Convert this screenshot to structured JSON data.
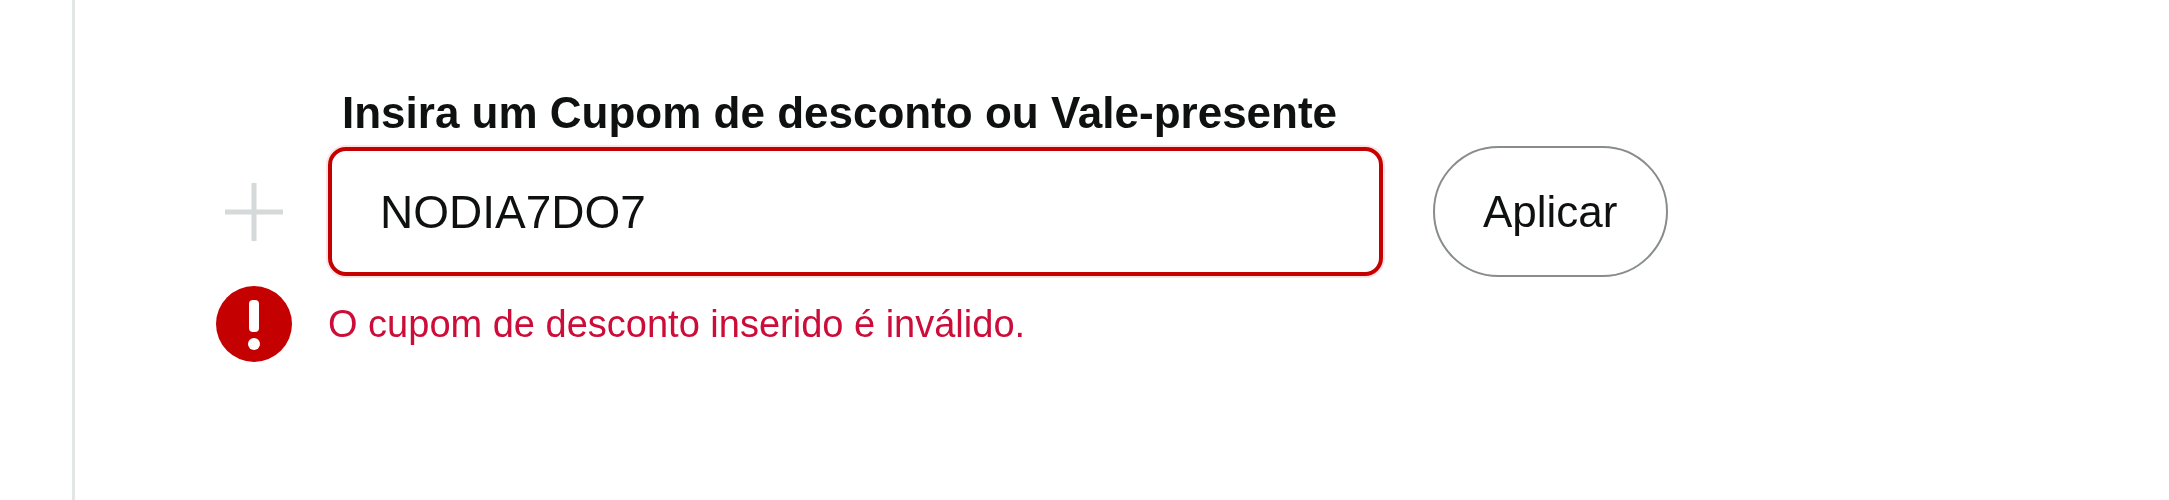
{
  "coupon": {
    "label": "Insira um Cupom de desconto ou Vale-presente",
    "value": "NODIA7DO7",
    "invalid": true,
    "error": "O cupom de desconto inserido é inválido."
  },
  "apply_button": "Aplicar"
}
